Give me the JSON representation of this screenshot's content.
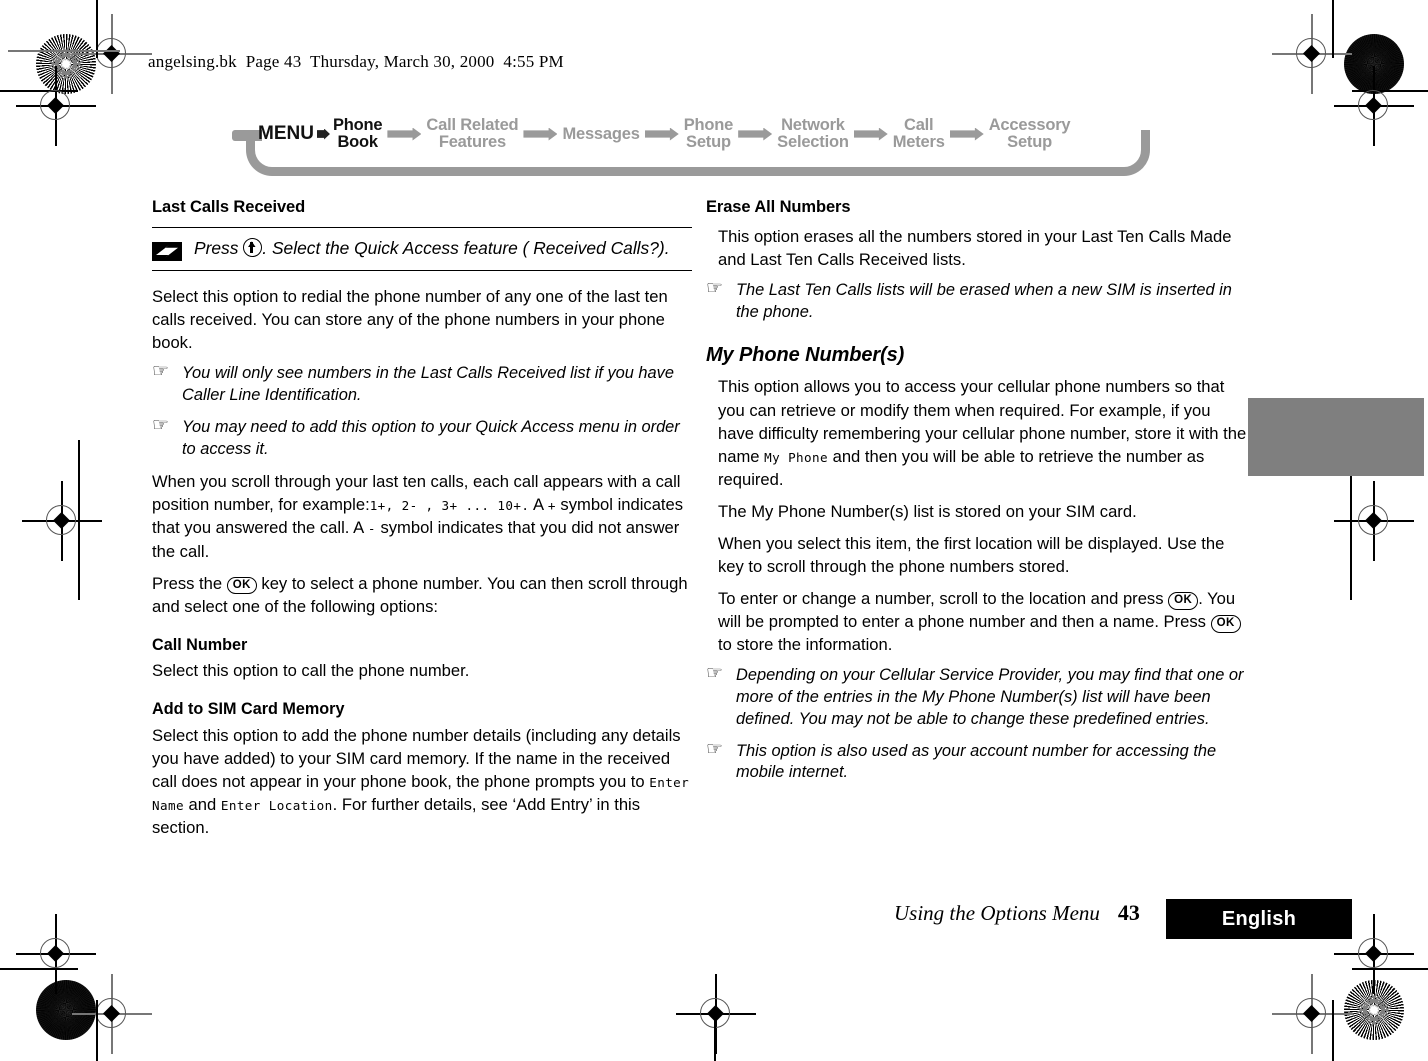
{
  "slug": {
    "text": "angelsing.bk  Page 43  Thursday, March 30, 2000  4:55 PM"
  },
  "nav": {
    "root_label": "MENU",
    "items": [
      {
        "label": "Phone\nBook",
        "active": true
      },
      {
        "label": "Call Related\nFeatures",
        "active": false
      },
      {
        "label": "Messages",
        "active": false
      },
      {
        "label": "Phone\nSetup",
        "active": false
      },
      {
        "label": "Network\nSelection",
        "active": false
      },
      {
        "label": "Call\nMeters",
        "active": false
      },
      {
        "label": "Accessory\nSetup",
        "active": false
      }
    ],
    "active_color": "#111111",
    "inactive_color": "#9a9a9a"
  },
  "left_column": {
    "heading": "Last Calls Received",
    "tip": {
      "icon": "lightning-bolt-icon",
      "text_before_key": "Press ",
      "key": "up-arrow-key",
      "text_after_key": ". Select the Quick Access feature ( Received Calls?)."
    },
    "para1": "Select this option to redial the phone number of any one of the last ten calls received. You can store any of the phone numbers in your phone book.",
    "note1": "You will only see numbers in the Last Calls Received list if you have Caller Line Identification.",
    "note2": "You may need to add this option to your Quick Access menu in order to access it.",
    "para2_a": "When you scroll through your last ten calls, each call appears with a call position number, for example:",
    "para2_lcd1": "1+, 2- , 3+ ... 10+.",
    "para2_b": " A ",
    "para2_lcd2": "+",
    "para2_c": " symbol indicates that you answered the call. A ",
    "para2_lcd3": "-",
    "para2_d": "  symbol indicates that you did not answer the call.",
    "para3_a": "Press the ",
    "para3_key": "OK",
    "para3_b": " key to select a phone number. You can then scroll through and select one of the following options:",
    "sub1_heading": "Call Number",
    "sub1_body": "Select this option to call the phone number.",
    "sub2_heading": "Add to SIM Card Memory",
    "sub2_a": "Select this option to add the phone number details (including any details you have added) to your SIM card memory. If the name in the received call does not appear in your phone book, the phone prompts you to ",
    "sub2_lcd1": "Enter Name",
    "sub2_b": " and ",
    "sub2_lcd2": "Enter Location",
    "sub2_c": ". For further details, see ‘Add Entry’ in this section."
  },
  "right_column": {
    "heading1": "Erase All Numbers",
    "para1": "This option erases all the numbers stored in your Last Ten Calls Made and Last Ten Calls Received lists.",
    "note1": "The Last Ten Calls lists will be erased when a new SIM is inserted in the phone.",
    "heading2": "My Phone Number(s)",
    "para2_a": "This option allows you to access your cellular phone numbers so that you can retrieve or modify them when required. For example, if you have difficulty remembering your cellular phone number, store it with the name ",
    "para2_lcd": "My Phone",
    "para2_b": " and then you will be able to retrieve the number as required.",
    "para3": "The My Phone Number(s) list is stored on your SIM card.",
    "para4_a": "When you select this item, the first location will be displayed. Use the ",
    "para4_key": "scroll-key-glyph",
    "para4_b": " key to scroll through the phone numbers stored.",
    "para5_a": "To enter or change a number, scroll to the location and press ",
    "para5_key1": "OK",
    "para5_b": ". You will be prompted to enter a phone number and then a name. Press ",
    "para5_key2": "OK",
    "para5_c": " to store the information.",
    "note2": "Depending on your Cellular Service Provider, you may find that one or more of the entries in the My Phone Number(s) list will have been defined. You may not be able to change these predefined entries.",
    "note3": "This option is also used as your account number for accessing the mobile internet."
  },
  "note_marker": "☞",
  "footer": {
    "title": "Using the Options Menu",
    "page_number": "43",
    "language": "English"
  },
  "thumb_tab": {
    "color": "#7f7f7f"
  }
}
